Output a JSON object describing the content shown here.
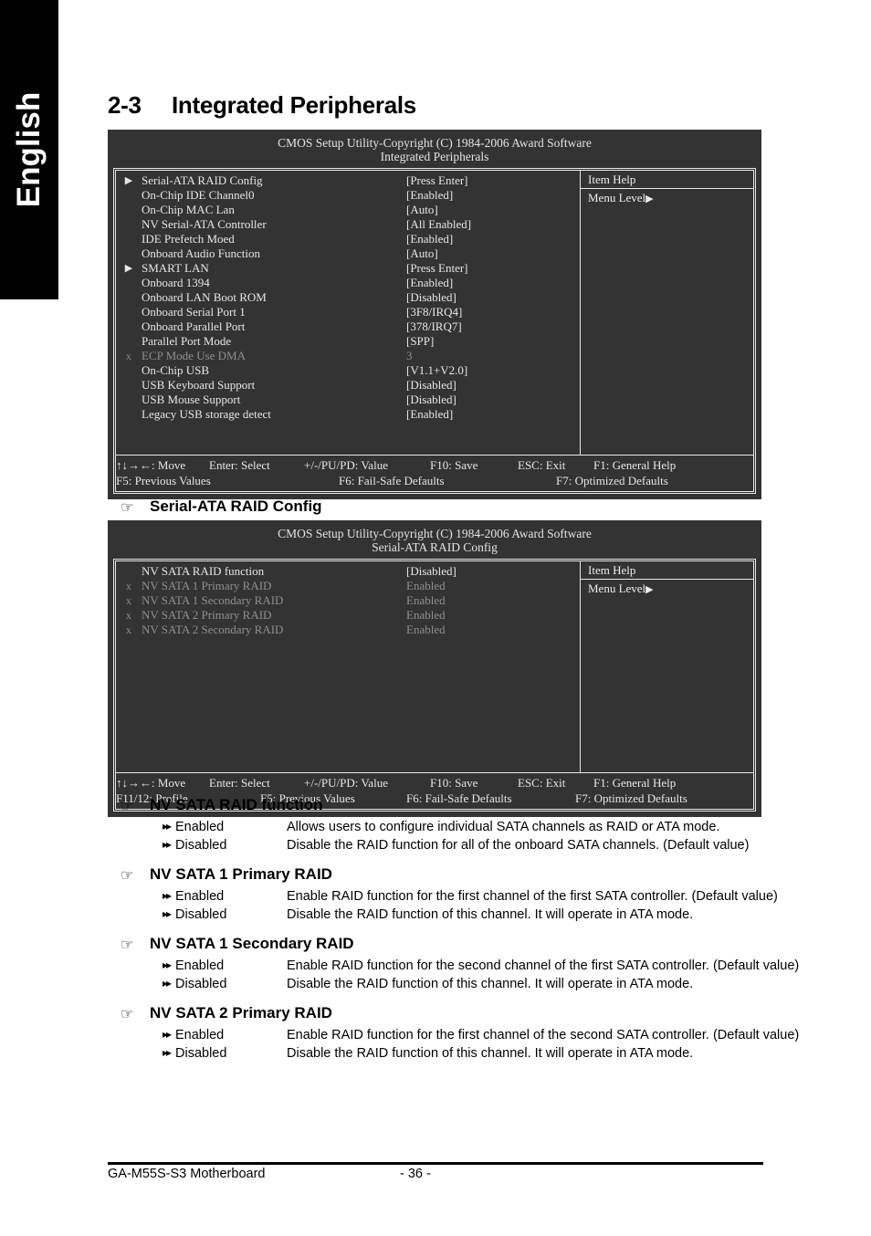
{
  "language_tab": {
    "label": "English"
  },
  "page": {
    "section_number": "2-3",
    "section_title": "Integrated Peripherals"
  },
  "bios_screen_1": {
    "title_line1": "CMOS Setup Utility-Copyright (C) 1984-2006 Award Software",
    "title_line2": "Integrated Peripherals",
    "help_title": "Item Help",
    "help_body": "Menu Level",
    "help_arrow": "▶",
    "rows": [
      {
        "mark": "▶",
        "label": "Serial-ATA RAID Config",
        "value": "[Press Enter]",
        "dim": false
      },
      {
        "mark": "",
        "label": "On-Chip IDE Channel0",
        "value": "[Enabled]",
        "dim": false
      },
      {
        "mark": "",
        "label": "On-Chip MAC Lan",
        "value": "[Auto]",
        "dim": false
      },
      {
        "mark": "",
        "label": "NV Serial-ATA Controller",
        "value": "[All Enabled]",
        "dim": false
      },
      {
        "mark": "",
        "label": "IDE Prefetch Moed",
        "value": "[Enabled]",
        "dim": false
      },
      {
        "mark": "",
        "label": "Onboard Audio Function",
        "value": "[Auto]",
        "dim": false
      },
      {
        "mark": "▶",
        "label": "SMART LAN",
        "value": "[Press Enter]",
        "dim": false
      },
      {
        "mark": "",
        "label": "Onboard 1394",
        "value": "[Enabled]",
        "dim": false
      },
      {
        "mark": "",
        "label": "Onboard LAN Boot ROM",
        "value": "[Disabled]",
        "dim": false
      },
      {
        "mark": "",
        "label": "Onboard Serial Port 1",
        "value": "[3F8/IRQ4]",
        "dim": false
      },
      {
        "mark": "",
        "label": "Onboard Parallel Port",
        "value": "[378/IRQ7]",
        "dim": false
      },
      {
        "mark": "",
        "label": "Parallel Port Mode",
        "value": "[SPP]",
        "dim": false
      },
      {
        "mark": "x",
        "label": "ECP Mode Use DMA",
        "value": "3",
        "dim": true
      },
      {
        "mark": "",
        "label": "On-Chip USB",
        "value": "[V1.1+V2.0]",
        "dim": false
      },
      {
        "mark": "",
        "label": "USB Keyboard Support",
        "value": "[Disabled]",
        "dim": false
      },
      {
        "mark": "",
        "label": "USB Mouse Support",
        "value": "[Disabled]",
        "dim": false
      },
      {
        "mark": "",
        "label": "Legacy USB storage detect",
        "value": "[Enabled]",
        "dim": false
      }
    ],
    "footer_row1": [
      "↑↓→←: Move",
      "Enter: Select",
      "+/-/PU/PD: Value",
      "F10: Save",
      "ESC: Exit",
      "F1: General Help"
    ],
    "footer_row2": [
      "F5: Previous Values",
      "F6: Fail-Safe Defaults",
      "F7: Optimized Defaults"
    ]
  },
  "subsection_1": {
    "hand_icon": "☞",
    "title": "Serial-ATA RAID Config"
  },
  "bios_screen_2": {
    "title_line1": "CMOS Setup Utility-Copyright (C) 1984-2006 Award Software",
    "title_line2": "Serial-ATA RAID Config",
    "help_title": "Item Help",
    "help_body": "Menu Level",
    "help_arrow": "▶",
    "rows": [
      {
        "mark": "",
        "label": "NV SATA RAID function",
        "value": "[Disabled]",
        "dim": false
      },
      {
        "mark": "x",
        "label": "NV SATA 1 Primary RAID",
        "value": "Enabled",
        "dim": true
      },
      {
        "mark": "x",
        "label": "NV SATA 1 Secondary RAID",
        "value": "Enabled",
        "dim": true
      },
      {
        "mark": "x",
        "label": "NV SATA 2 Primary RAID",
        "value": "Enabled",
        "dim": true
      },
      {
        "mark": "x",
        "label": "NV SATA 2 Secondary RAID",
        "value": "Enabled",
        "dim": true
      }
    ],
    "footer_row1": [
      "↑↓→←: Move",
      "Enter: Select",
      "+/-/PU/PD: Value",
      "F10: Save",
      "ESC: Exit",
      "F1: General Help"
    ],
    "footer_row2": [
      "F11/12: Profile",
      "F5: Previous Values",
      "F6: Fail-Safe Defaults",
      "F7: Optimized Defaults"
    ]
  },
  "descriptions": [
    {
      "hand_icon": "☞",
      "title": "NV SATA RAID function",
      "options": [
        {
          "bullet": "▸▸",
          "name": "Enabled",
          "text": "Allows users to configure individual SATA channels as RAID or ATA mode."
        },
        {
          "bullet": "▸▸",
          "name": "Disabled",
          "text": "Disable the RAID function for all of the onboard SATA channels. (Default value)"
        }
      ]
    },
    {
      "hand_icon": "☞",
      "title": "NV SATA 1 Primary RAID",
      "options": [
        {
          "bullet": "▸▸",
          "name": "Enabled",
          "text": "Enable RAID function for the first channel of the first SATA controller. (Default value)"
        },
        {
          "bullet": "▸▸",
          "name": "Disabled",
          "text": "Disable the RAID function of this channel. It will operate in ATA mode."
        }
      ]
    },
    {
      "hand_icon": "☞",
      "title": "NV SATA 1 Secondary RAID",
      "options": [
        {
          "bullet": "▸▸",
          "name": "Enabled",
          "text": "Enable RAID function for the second channel of the first SATA controller. (Default value)"
        },
        {
          "bullet": "▸▸",
          "name": "Disabled",
          "text": "Disable the RAID function of this channel. It will operate in ATA mode."
        }
      ]
    },
    {
      "hand_icon": "☞",
      "title": "NV SATA 2 Primary RAID",
      "options": [
        {
          "bullet": "▸▸",
          "name": "Enabled",
          "text": "Enable RAID function for the first channel of the second SATA controller. (Default value)"
        },
        {
          "bullet": "▸▸",
          "name": "Disabled",
          "text": "Disable the RAID function of this channel. It will operate in ATA mode."
        }
      ]
    }
  ],
  "footer": {
    "product": "GA-M55S-S3 Motherboard",
    "page_number": "- 36 -"
  },
  "colors": {
    "bios_background": "#333333",
    "bios_text": "#e6e6e6",
    "bios_dim_text": "#8f8f8f",
    "tab_background": "#000000",
    "tab_text": "#ffffff"
  }
}
